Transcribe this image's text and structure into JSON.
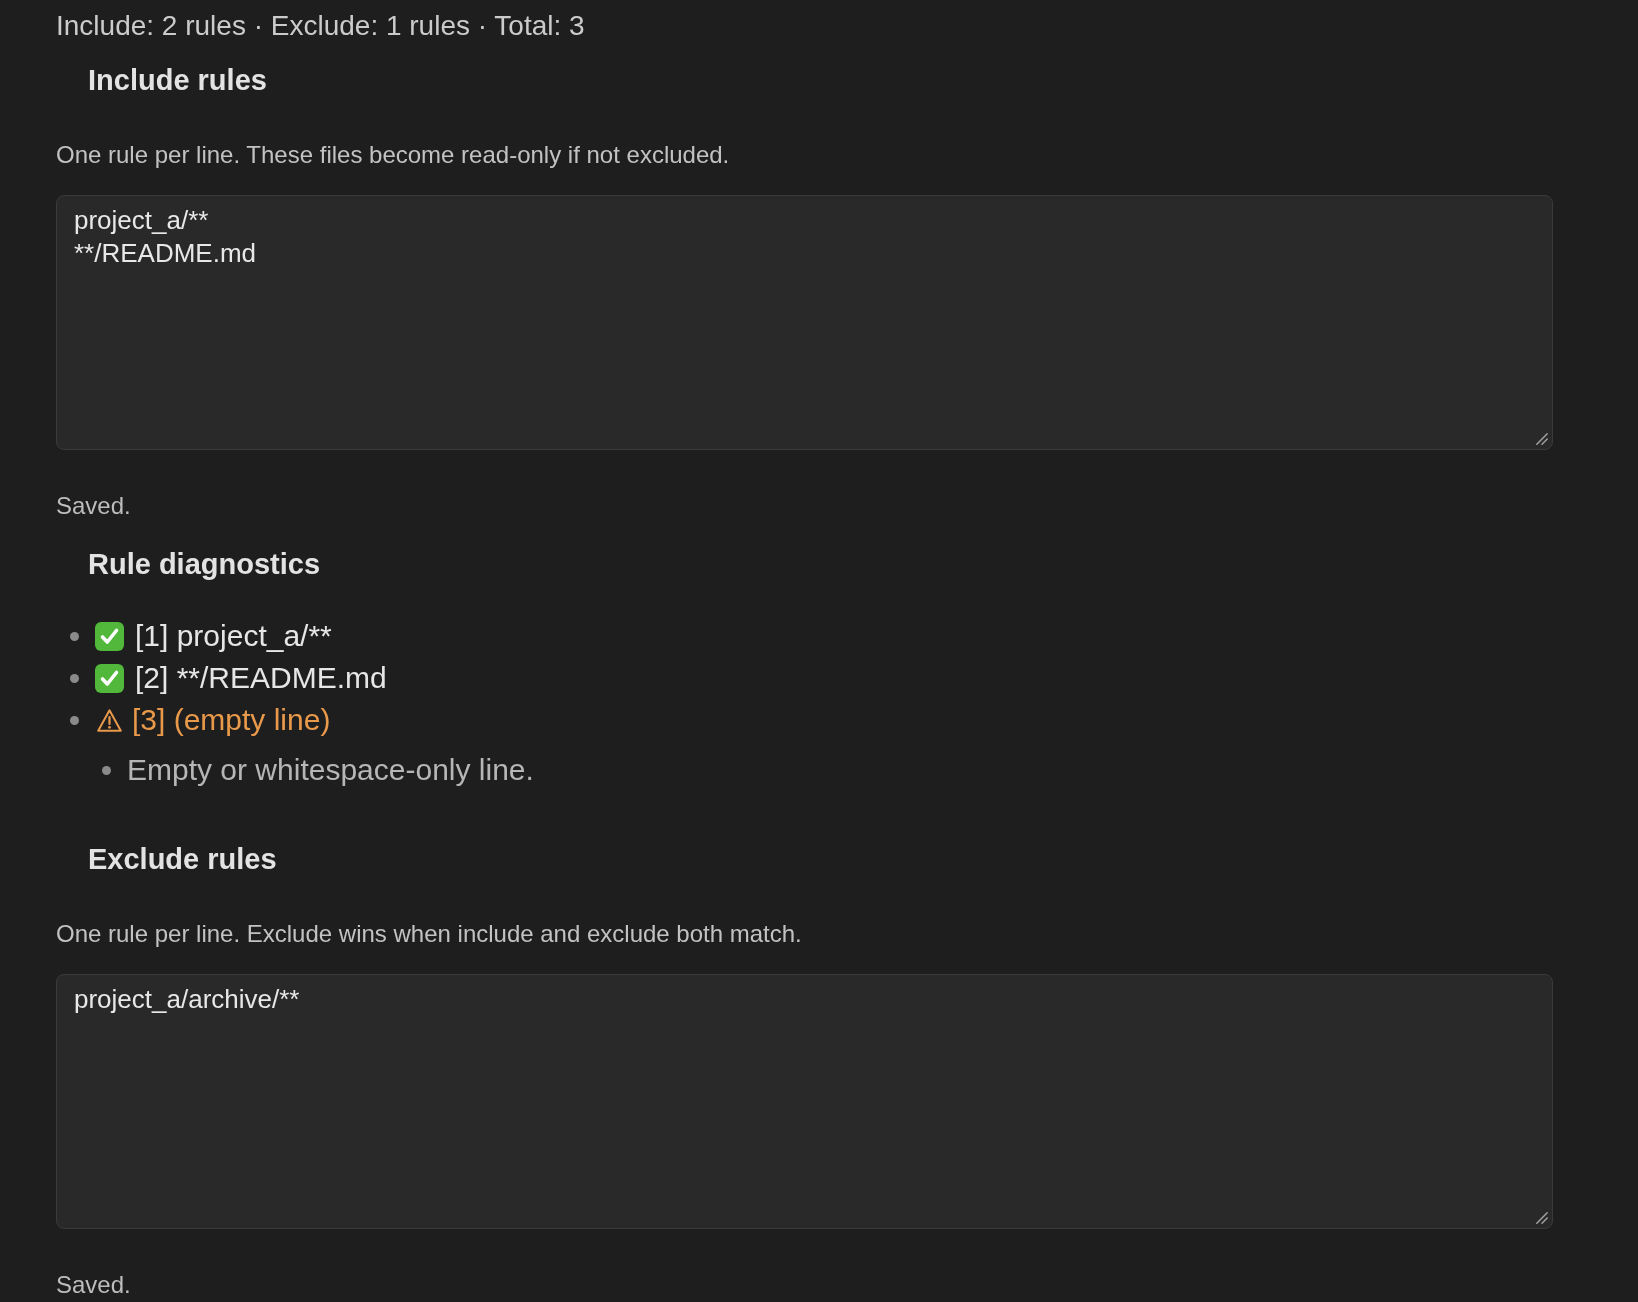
{
  "summary": "Include: 2 rules · Exclude: 1 rules · Total: 3",
  "include_rules": {
    "heading": "Include rules",
    "description": "One rule per line. These files become read-only if not excluded.",
    "lines": [
      "project_a/**",
      "**/README.md"
    ],
    "status": "Saved."
  },
  "diagnostics": {
    "heading": "Rule diagnostics",
    "items": [
      {
        "kind": "ok",
        "label": "[1] project_a/**"
      },
      {
        "kind": "ok",
        "label": "[2] **/README.md"
      },
      {
        "kind": "warning",
        "label": "[3] (empty line)",
        "notes": [
          "Empty or whitespace-only line."
        ]
      }
    ]
  },
  "exclude_rules": {
    "heading": "Exclude rules",
    "description": "One rule per line. Exclude wins when include and exclude both match.",
    "lines": [
      "project_a/archive/**"
    ],
    "status": "Saved."
  }
}
